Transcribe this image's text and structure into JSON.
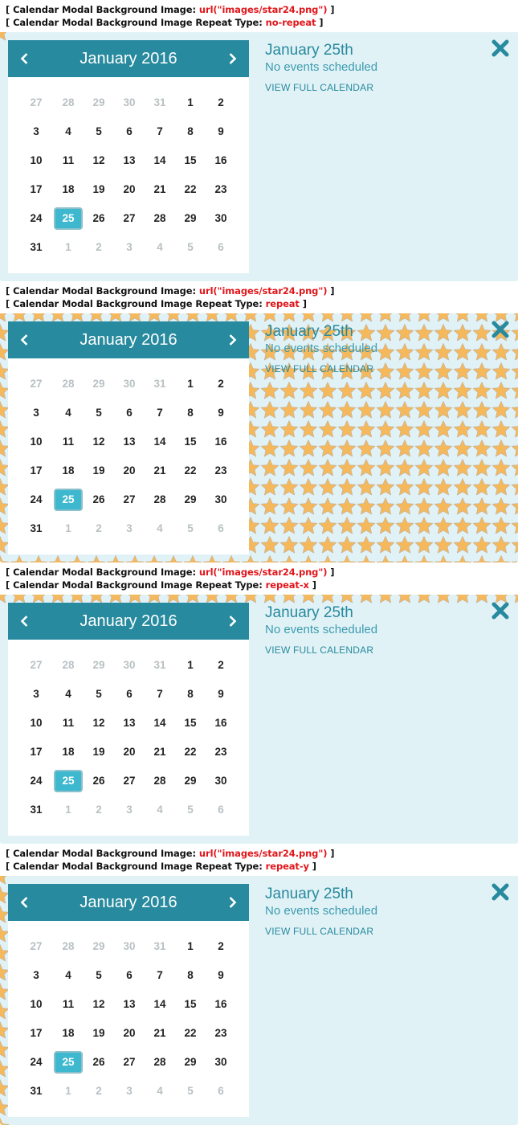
{
  "label_prefix_image": "Calendar Modal Background Image:",
  "label_prefix_repeat": "Calendar Modal Background Image Repeat Type:",
  "background_image_value": "url(\"images/star24.png\")",
  "colors": {
    "header": "#278a9e",
    "modal_bg": "#e1f2f6",
    "selected_day": "#3db8cf",
    "label_value": "#e0161b",
    "star": "#f5b85a"
  },
  "icons": {
    "prev": "chevron-left-icon",
    "next": "chevron-right-icon",
    "close": "close-icon",
    "star": "star-icon"
  },
  "calendar": {
    "month_title": "January 2016",
    "rows": [
      [
        "27",
        "28",
        "29",
        "30",
        "31",
        "1",
        "2"
      ],
      [
        "3",
        "4",
        "5",
        "6",
        "7",
        "8",
        "9"
      ],
      [
        "10",
        "11",
        "12",
        "13",
        "14",
        "15",
        "16"
      ],
      [
        "17",
        "18",
        "19",
        "20",
        "21",
        "22",
        "23"
      ],
      [
        "24",
        "25",
        "26",
        "27",
        "28",
        "29",
        "30"
      ],
      [
        "31",
        "1",
        "2",
        "3",
        "4",
        "5",
        "6"
      ]
    ],
    "selected_day": "25"
  },
  "event_panel": {
    "date_title": "January 25th",
    "status": "No events scheduled",
    "link": "VIEW FULL CALENDAR"
  },
  "sections": [
    {
      "repeat_type": "no-repeat"
    },
    {
      "repeat_type": "repeat"
    },
    {
      "repeat_type": "repeat-x"
    },
    {
      "repeat_type": "repeat-y"
    }
  ]
}
